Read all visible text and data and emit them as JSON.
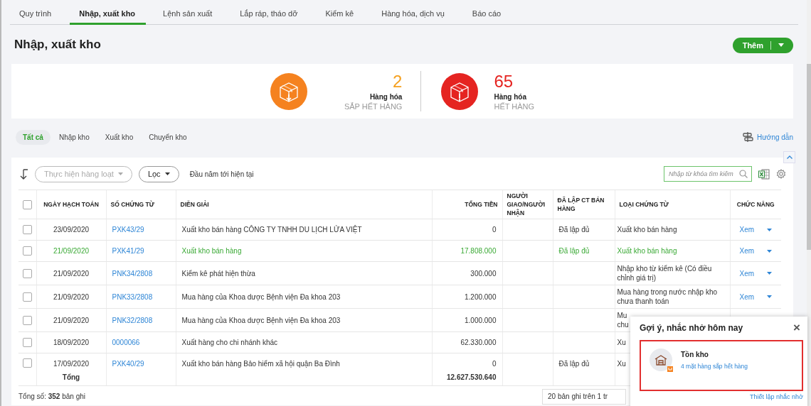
{
  "tabs": [
    {
      "label": "Quy trình",
      "selected": false
    },
    {
      "label": "Nhập, xuất kho",
      "selected": true
    },
    {
      "label": "Lệnh sản xuất",
      "selected": false
    },
    {
      "label": "Lắp ráp, tháo dỡ",
      "selected": false
    },
    {
      "label": "Kiểm kê",
      "selected": false
    },
    {
      "label": "Hàng hóa, dịch vụ",
      "selected": false
    },
    {
      "label": "Báo cáo",
      "selected": false
    }
  ],
  "page_title": "Nhập, xuất kho",
  "add_button": {
    "label": "Thêm"
  },
  "stats": [
    {
      "kind": "low",
      "count": "2",
      "label": "Hàng hóa",
      "caption": "SẮP HẾT HÀNG"
    },
    {
      "kind": "out",
      "count": "65",
      "label": "Hàng hóa",
      "caption": "HẾT HÀNG"
    }
  ],
  "filter_tabs": [
    {
      "label": "Tất cả",
      "selected": true
    },
    {
      "label": "Nhập kho",
      "selected": false
    },
    {
      "label": "Xuất kho",
      "selected": false
    },
    {
      "label": "Chuyển kho",
      "selected": false
    }
  ],
  "guide_link": "Hướng dẫn",
  "toolbar": {
    "bulk_action": {
      "label": "Thực hiện hàng loạt",
      "disabled": true
    },
    "filter_button": "Lọc",
    "period": "Đầu năm tới hiện tại"
  },
  "search": {
    "placeholder": "Nhập từ khóa tìm kiếm"
  },
  "table": {
    "header_checked": false,
    "columns": [
      "NGÀY HẠCH TOÁN",
      "SỐ CHỨNG TỪ",
      "DIỄN GIẢI",
      "TỔNG TIỀN",
      "NGƯỜI GIAO/NGƯỜI NHẬN",
      "ĐÃ LẬP CT BÁN HÀNG",
      "LOẠI CHỨNG TỪ",
      "CHỨC NĂNG"
    ],
    "rows": [
      {
        "checked": false,
        "highlighted": false,
        "date": "23/09/2020",
        "number": "PXK43/29",
        "description": "Xuất kho bán hàng CÔNG TY TNHH DU LỊCH LỬA VIỆT",
        "total": "0",
        "sales_status": "Đã lập đủ",
        "doc_type": "Xuất kho bán hàng",
        "action": "Xem"
      },
      {
        "checked": false,
        "highlighted": true,
        "date": "21/09/2020",
        "number": "PXK41/29",
        "description": "Xuất kho bán hàng",
        "total": "17.808.000",
        "sales_status": "Đã lập đủ",
        "doc_type": "Xuất kho bán hàng",
        "action": "Xem"
      },
      {
        "checked": false,
        "highlighted": false,
        "date": "21/09/2020",
        "number": "PNK34/2808",
        "description": "Kiểm kê phát hiện thừa",
        "total": "300.000",
        "doc_type": "Nhập kho từ kiểm kê (Có điều chỉnh giá trị)",
        "action": "Xem"
      },
      {
        "checked": false,
        "highlighted": false,
        "date": "21/09/2020",
        "number": "PNK33/2808",
        "description": "Mua hàng của Khoa dược Bệnh viện Đa khoa 203",
        "total": "1.200.000",
        "doc_type": "Mua hàng trong nước nhập kho chưa thanh toán",
        "action": "Xem"
      },
      {
        "checked": false,
        "highlighted": false,
        "date": "21/09/2020",
        "number": "PNK32/2808",
        "description": "Mua hàng của Khoa dược Bệnh viện Đa khoa 203",
        "total": "1.000.000",
        "doc_type": "Mu chu"
      },
      {
        "checked": false,
        "highlighted": false,
        "date": "18/09/2020",
        "number": "0000066",
        "description": "Xuất hàng cho chi nhánh khác",
        "total": "62.330.000",
        "doc_type": "Xu"
      },
      {
        "checked": false,
        "highlighted": false,
        "date": "17/09/2020",
        "number": "PXK40/29",
        "description": "Xuất kho bán hàng Bảo hiểm xã hội quận Ba Đình",
        "total": "0",
        "sales_status": "Đã lập đủ",
        "doc_type": "Xu"
      }
    ],
    "total": {
      "label": "Tổng",
      "amount": "12.627.530.640"
    }
  },
  "footer": {
    "record_count": "Tổng số: **352** bản ghi",
    "pager": "20 bản ghi trên 1 tr"
  },
  "reminder": {
    "title": "Gợi ý, nhắc nhở hôm nay",
    "close": "×",
    "items": [
      {
        "title": "Tồn kho",
        "link": "4 mặt hàng sắp hết hàng"
      }
    ],
    "settings_link": "Thiết lập nhắc nhở"
  }
}
